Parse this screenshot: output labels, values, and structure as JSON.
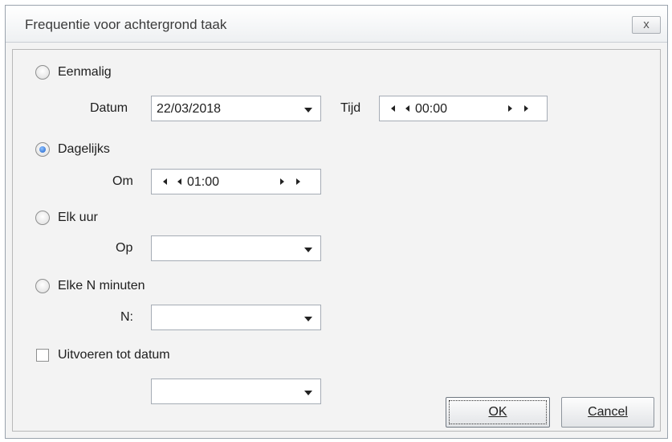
{
  "window": {
    "title": "Frequentie voor achtergrond taak",
    "close_label": "x"
  },
  "options": {
    "once": {
      "label": "Eenmalig",
      "checked": false
    },
    "daily": {
      "label": "Dagelijks",
      "checked": true
    },
    "hourly": {
      "label": "Elk uur",
      "checked": false
    },
    "every_n": {
      "label": "Elke N minuten",
      "checked": false
    },
    "until": {
      "label": "Uitvoeren tot datum",
      "checked": false
    }
  },
  "once": {
    "date_label": "Datum",
    "date_value": "22/03/2018",
    "time_label": "Tijd",
    "time_value": "00:00"
  },
  "daily": {
    "at_label": "Om",
    "at_value": "01:00"
  },
  "hourly": {
    "on_label": "Op",
    "on_value": ""
  },
  "every_n": {
    "n_label": "N:",
    "n_value": ""
  },
  "until": {
    "date_value": ""
  },
  "buttons": {
    "ok": "OK",
    "cancel": "Cancel"
  }
}
